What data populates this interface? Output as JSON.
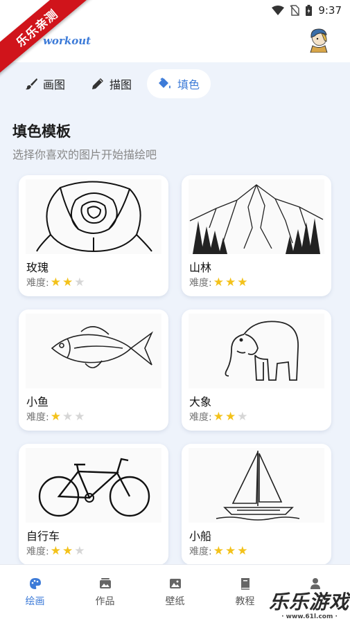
{
  "status_bar": {
    "time": "9:37"
  },
  "ribbon": {
    "text": "乐乐亲测"
  },
  "app": {
    "logo_text": "workout"
  },
  "tabs": [
    {
      "label": "画图",
      "icon": "brush-icon"
    },
    {
      "label": "描图",
      "icon": "pencil-icon"
    },
    {
      "label": "填色",
      "icon": "paint-bucket-icon",
      "active": true
    }
  ],
  "section": {
    "title": "填色模板",
    "subtitle": "选择你喜欢的图片开始描绘吧"
  },
  "difficulty_label": "难度:",
  "templates": [
    {
      "name": "玫瑰",
      "stars": 2
    },
    {
      "name": "山林",
      "stars": 3
    },
    {
      "name": "小鱼",
      "stars": 1
    },
    {
      "name": "大象",
      "stars": 2
    },
    {
      "name": "自行车",
      "stars": 2
    },
    {
      "name": "小船",
      "stars": 3
    }
  ],
  "bottom_nav": [
    {
      "label": "绘画",
      "icon": "palette-icon",
      "active": true
    },
    {
      "label": "作品",
      "icon": "gallery-icon"
    },
    {
      "label": "壁纸",
      "icon": "image-icon"
    },
    {
      "label": "教程",
      "icon": "book-icon"
    },
    {
      "label": "",
      "icon": "person-icon"
    }
  ],
  "watermark": {
    "title": "乐乐游戏",
    "url": "· www.61l.com ·"
  },
  "colors": {
    "accent": "#3d7bd8",
    "star": "#f3c21b",
    "ribbon": "#d0141b"
  }
}
